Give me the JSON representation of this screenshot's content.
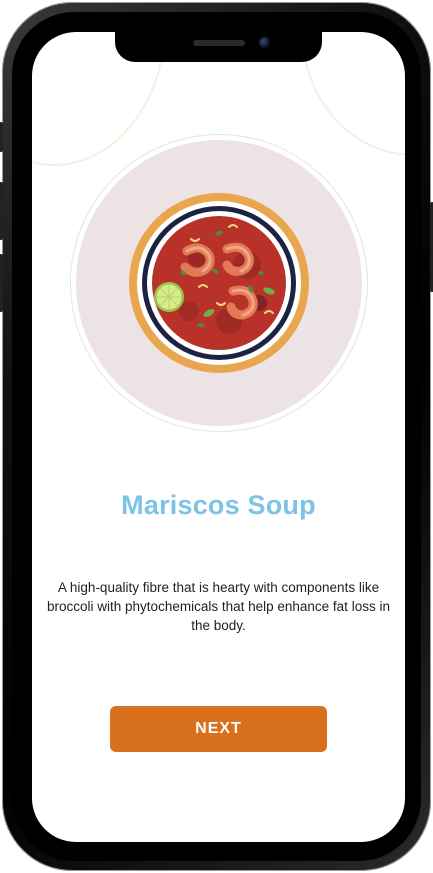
{
  "onboarding": {
    "title": "Mariscos Soup",
    "description": "A high-quality fibre that is hearty with components like broccoli with phytochemicals that help enhance fat loss in the body.",
    "next_label": "NEXT"
  },
  "illustration": {
    "name": "seafood-soup-bowl",
    "colors": {
      "plate_background": "#eee3e4",
      "bowl_rim": "#e8a64e",
      "bowl_ring": "#1b2340",
      "soup": "#b8322a",
      "shrimp": "#e27a58",
      "lime": "#d8ea8a"
    }
  },
  "colors": {
    "title": "#7cc3e6",
    "button": "#d9701e",
    "button_text": "#ffffff",
    "text": "#222222"
  }
}
